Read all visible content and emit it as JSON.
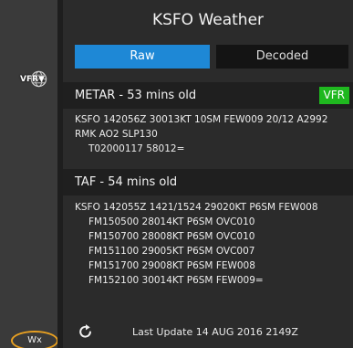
{
  "sidebar": {
    "vfr_button": {
      "label": "VFR▼",
      "icon": "globe-icon"
    },
    "wx_button": {
      "label": "Wx",
      "highlight_color": "#e8a021"
    }
  },
  "header": {
    "title": "KSFO  Weather"
  },
  "tabs": [
    {
      "label": "Raw",
      "active": true
    },
    {
      "label": "Decoded",
      "active": false
    }
  ],
  "metar": {
    "title": "METAR - 53 mins old",
    "flight_category": "VFR",
    "category_color": "#1fb81f",
    "lines": [
      "KSFO 142056Z 30013KT 10SM FEW009 20/12 A2992",
      "RMK AO2 SLP130",
      "T02000117 58012="
    ]
  },
  "taf": {
    "title": "TAF - 54 mins old",
    "lines": [
      "KSFO 142055Z 1421/1524 29020KT P6SM FEW008",
      "FM150500 28014KT P6SM OVC010",
      "FM150700 28008KT P6SM OVC010",
      "FM151100 29005KT P6SM OVC007",
      "FM151700 29008KT P6SM FEW008",
      "FM152100 30014KT P6SM FEW009="
    ]
  },
  "footer": {
    "refresh_icon": "refresh-icon",
    "last_update": "Last Update  14 AUG 2016  2149Z"
  },
  "colors": {
    "accent": "#1e88d6"
  }
}
